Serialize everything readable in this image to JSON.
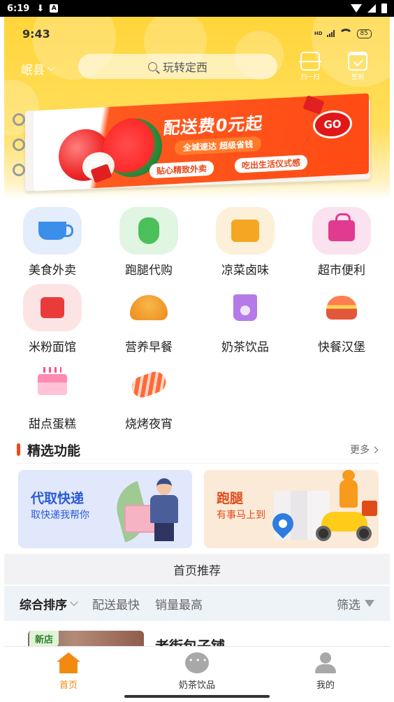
{
  "system_status": {
    "time": "6:19",
    "app_letter": "A"
  },
  "app_status": {
    "time": "9:43",
    "network_tag": "HD",
    "battery": "85"
  },
  "header": {
    "location": "岷县",
    "search_placeholder": "玩转定西",
    "scan_label": "扫一扫",
    "checkin_label": "签到",
    "accent_color": "#ffd53a"
  },
  "banner": {
    "title": "配送费0元起",
    "subtitle": "全城速达 超级省钱",
    "go_label": "GO",
    "tag_left": "贴心精致外卖",
    "tag_right": "吃出生活仪式感"
  },
  "categories": [
    {
      "label": "美食外卖",
      "icon": "coffee-cup-icon",
      "bg": "#e4edfb"
    },
    {
      "label": "跑腿代购",
      "icon": "footprint-icon",
      "bg": "#e1f5e3"
    },
    {
      "label": "凉菜卤味",
      "icon": "food-box-icon",
      "bg": "#fdf0d9"
    },
    {
      "label": "超市便利",
      "icon": "shopping-bag-icon",
      "bg": "#fbe2ef"
    },
    {
      "label": "米粉面馆",
      "icon": "thumbs-up-icon",
      "bg": "#fde4e4"
    },
    {
      "label": "营养早餐",
      "icon": "bun-icon",
      "bg": "transparent"
    },
    {
      "label": "奶茶饮品",
      "icon": "milk-tea-icon",
      "bg": "transparent"
    },
    {
      "label": "快餐汉堡",
      "icon": "burger-icon",
      "bg": "transparent"
    },
    {
      "label": "甜点蛋糕",
      "icon": "cake-icon",
      "bg": "transparent"
    },
    {
      "label": "烧烤夜宵",
      "icon": "sushi-icon",
      "bg": "transparent"
    }
  ],
  "featured": {
    "title": "精选功能",
    "more": "更多",
    "cards": [
      {
        "title": "代取快递",
        "subtitle": "取快递我帮你"
      },
      {
        "title": "跑腿",
        "subtitle": "有事马上到"
      }
    ]
  },
  "recommend_title": "首页推荐",
  "sort": {
    "items": [
      "综合排序",
      "配送最快",
      "销量最高"
    ],
    "filter": "筛选"
  },
  "shop": {
    "badge": "新店",
    "name": "老街包子铺"
  },
  "tabbar": {
    "items": [
      {
        "label": "首页",
        "active": true
      },
      {
        "label": "奶茶饮品",
        "active": false
      },
      {
        "label": "我的",
        "active": false
      }
    ],
    "active_color": "#f28a12"
  }
}
